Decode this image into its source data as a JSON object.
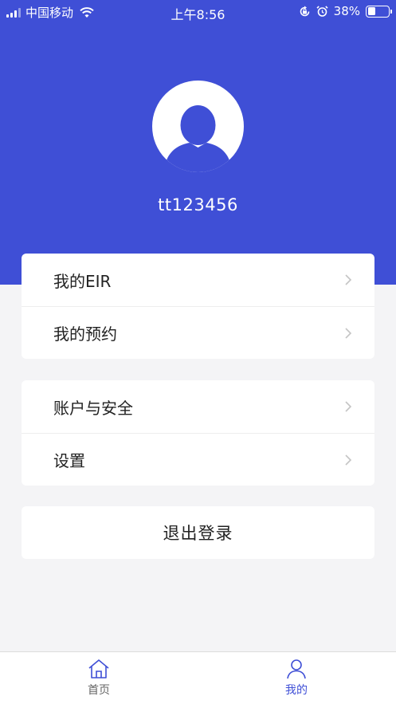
{
  "status_bar": {
    "carrier": "中国移动",
    "time": "上午8:56",
    "battery_percent": "38%",
    "battery_level": 0.38,
    "icons": [
      "signal-icon",
      "wifi-icon",
      "orientation-lock-icon",
      "alarm-icon",
      "battery-icon"
    ]
  },
  "profile": {
    "avatar_icon": "user-avatar-icon",
    "username": "tt123456"
  },
  "menu": {
    "group1": [
      {
        "label": "我的EIR"
      },
      {
        "label": "我的预约"
      }
    ],
    "group2": [
      {
        "label": "账户与安全"
      },
      {
        "label": "设置"
      }
    ]
  },
  "logout_label": "退出登录",
  "tabbar": {
    "home_label": "首页",
    "mine_label": "我的",
    "active_tab": "我的"
  },
  "colors": {
    "brand": "#3f4fd6",
    "background": "#f4f4f6",
    "chevron": "#c4c4c4"
  }
}
